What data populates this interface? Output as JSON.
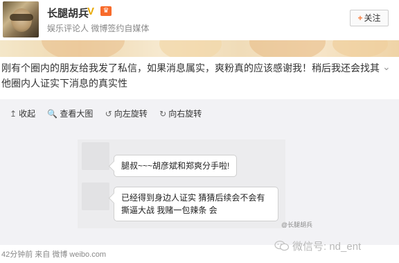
{
  "header": {
    "username": "长腿胡兵",
    "verified_badge": "V",
    "vip_badge": "♛",
    "bio": "娱乐评论人 微博签约自媒体",
    "follow_label": "关注",
    "follow_plus": "+",
    "avatar_icon": "user-avatar"
  },
  "post": {
    "text": "刚有个圈内的朋友给我发了私信，如果消息属实，爽粉真的应该感谢我！稍后我还会找其他圈内人证实下消息的真实性",
    "collapse_glyph": "⌄"
  },
  "media_toolbar": {
    "collapse": {
      "icon": "↥",
      "label": "收起"
    },
    "view_large": {
      "icon": "🔍",
      "label": "查看大图"
    },
    "rotate_left": {
      "icon": "↺",
      "label": "向左旋转"
    },
    "rotate_right": {
      "icon": "↻",
      "label": "向右旋转"
    }
  },
  "chat": {
    "message_1": "腿叔~~~胡彦斌和郑爽分手啦!",
    "message_2": "已经得到身边人证实 猜猜后续会不会有撕逼大战 我赌一包辣条 会",
    "small_watermark": "@长腿胡兵"
  },
  "footer": {
    "meta": "42分钟前 来自 微博 weibo.com",
    "wechat_watermark": "微信号: nd_ent"
  },
  "colors": {
    "accent_orange": "#f77c3d",
    "verified_gold": "#e8a900",
    "muted_text": "#888888",
    "media_bg": "#f2f2f5"
  }
}
